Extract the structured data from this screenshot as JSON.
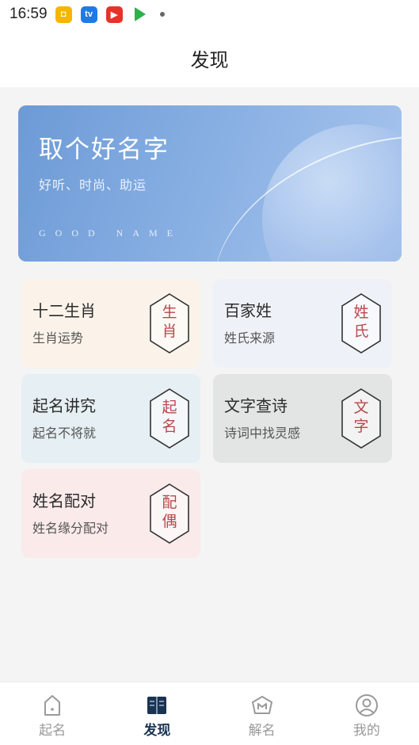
{
  "status_bar": {
    "time": "16:59"
  },
  "header": {
    "title": "发现"
  },
  "banner": {
    "title": "取个好名字",
    "subtitle": "好听、时尚、助运",
    "english": "GOOD  NAME"
  },
  "cards": [
    {
      "title": "十二生肖",
      "subtitle": "生肖运势",
      "seal": "生肖",
      "background": "#fbf3ea"
    },
    {
      "title": "百家姓",
      "subtitle": "姓氏来源",
      "seal": "姓氏",
      "background": "#eef2f8"
    },
    {
      "title": "起名讲究",
      "subtitle": "起名不将就",
      "seal": "起名",
      "background": "#e6eff3"
    },
    {
      "title": "文字查诗",
      "subtitle": "诗词中找灵感",
      "seal": "文字",
      "background": "#e2e5e3"
    },
    {
      "title": "姓名配对",
      "subtitle": "姓名缘分配对",
      "seal": "配偶",
      "background": "#fbeaea"
    }
  ],
  "tabs": [
    {
      "label": "起名",
      "icon": "name-tag-icon",
      "active": false
    },
    {
      "label": "发现",
      "icon": "book-icon",
      "active": true
    },
    {
      "label": "解名",
      "icon": "m-badge-icon",
      "active": false
    },
    {
      "label": "我的",
      "icon": "profile-icon",
      "active": false
    }
  ],
  "colors": {
    "accent": "#1a3350",
    "inactive": "#999999",
    "seal_red": "#b8484c"
  }
}
